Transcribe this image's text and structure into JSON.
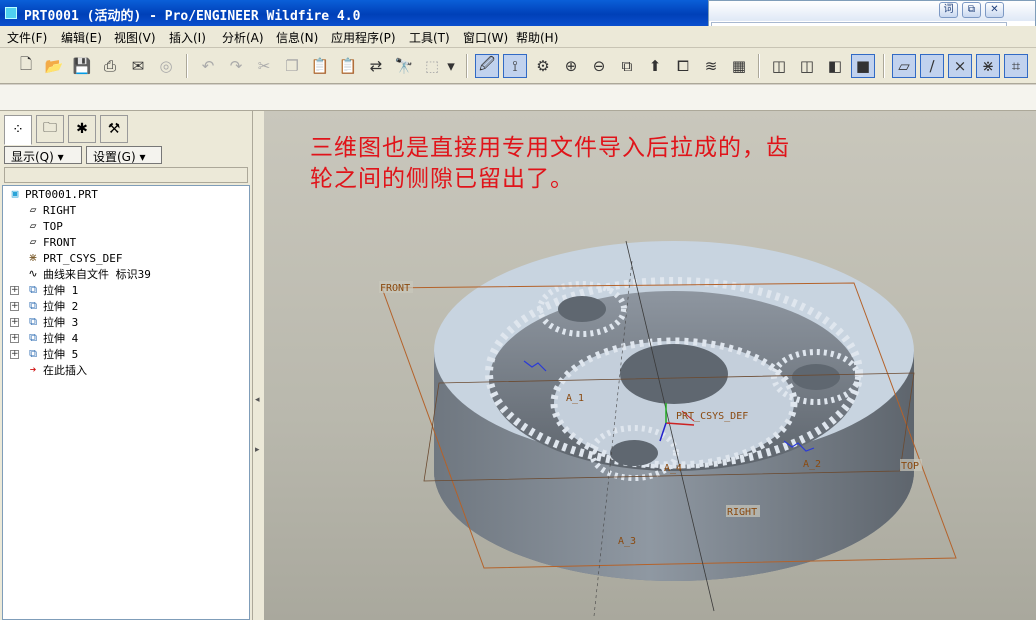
{
  "window": {
    "title": "PRT0001 (活动的) - Pro/ENGINEER Wildfire 4.0"
  },
  "popup": {
    "btn_dict": "词",
    "btn_restore": "⧉",
    "btn_close": "✕"
  },
  "menu": [
    "文件(F)",
    "编辑(E)",
    "视图(V)",
    "插入(I)",
    "分析(A)",
    "信息(N)",
    "应用程序(P)",
    "工具(T)",
    "窗口(W)",
    "帮助(H)"
  ],
  "toolbar_icons": [
    "new-icon",
    "open-icon",
    "save-icon",
    "print-icon",
    "send-icon",
    "mail-icon",
    "undo-icon",
    "redo-icon",
    "cut-icon",
    "copy-icon",
    "paste-icon",
    "paste-special-icon",
    "regenerate-icon",
    "find-icon",
    "select-box-icon",
    "redraw-icon",
    "spin-center-icon",
    "orient-icon",
    "zoom-in-icon",
    "zoom-out-icon",
    "refit-icon",
    "reorient-icon",
    "saved-views-icon",
    "layers-icon",
    "view-manager-icon",
    "wireframe-icon",
    "hidden-line-icon",
    "no-hidden-icon",
    "shading-icon",
    "datum-plane-icon",
    "datum-axis-icon",
    "datum-point-icon",
    "csys-icon",
    "annotation-icon"
  ],
  "navigator": {
    "show_button": "显示(Q)",
    "settings_button": "设置(G)",
    "tree": [
      {
        "label": "PRT0001.PRT",
        "icon": "part-icon",
        "expandable": false
      },
      {
        "label": "RIGHT",
        "icon": "datum-plane-icon",
        "expandable": false
      },
      {
        "label": "TOP",
        "icon": "datum-plane-icon",
        "expandable": false
      },
      {
        "label": "FRONT",
        "icon": "datum-plane-icon",
        "expandable": false
      },
      {
        "label": "PRT_CSYS_DEF",
        "icon": "csys-icon",
        "expandable": false
      },
      {
        "label": "曲线来自文件 标识39",
        "icon": "curve-icon",
        "expandable": false
      },
      {
        "label": "拉伸 1",
        "icon": "extrude-icon",
        "expandable": true
      },
      {
        "label": "拉伸 2",
        "icon": "extrude-icon",
        "expandable": true
      },
      {
        "label": "拉伸 3",
        "icon": "extrude-icon",
        "expandable": true
      },
      {
        "label": "拉伸 4",
        "icon": "extrude-icon",
        "expandable": true
      },
      {
        "label": "拉伸 5",
        "icon": "extrude-icon",
        "expandable": true
      },
      {
        "label": "在此插入",
        "icon": "insert-arrow-icon",
        "expandable": false
      }
    ]
  },
  "viewport": {
    "note": "三维图也是直接用专用文件导入后拉成的，齿轮之间的侧隙已留出了。",
    "datum_labels": {
      "front": "FRONT",
      "top": "TOP",
      "right": "RIGHT",
      "csys": "PRT_CSYS_DEF",
      "a1": "A_1",
      "a2": "A_2",
      "a3": "A_3",
      "a4": "A_4"
    },
    "colors": {
      "note_text": "#e0141a",
      "part_face": "#c8d4e0",
      "part_side": "#7d858f",
      "datum": "#b4622a"
    }
  }
}
